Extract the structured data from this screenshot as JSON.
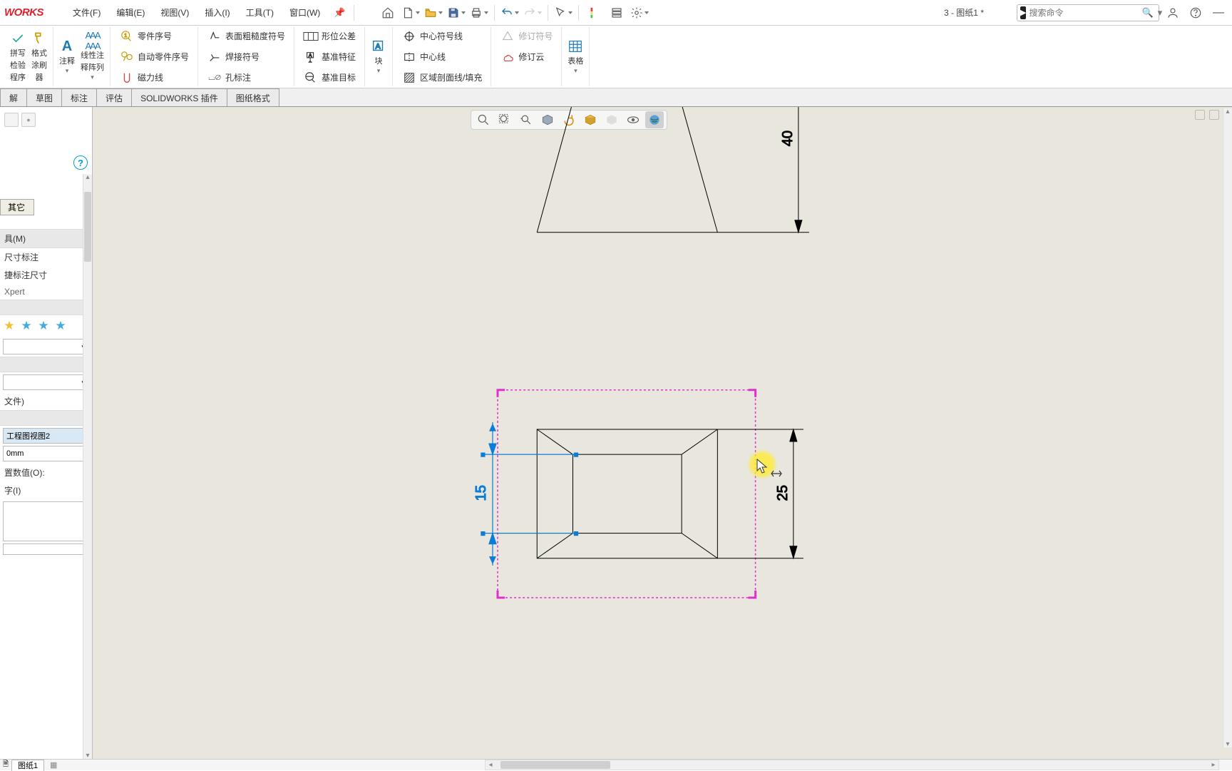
{
  "app": {
    "logo": "WORKS",
    "doc_title": "3 - 图纸1 *"
  },
  "menu": {
    "file": "文件(F)",
    "edit": "编辑(E)",
    "view": "视图(V)",
    "insert": "插入(I)",
    "tools": "工具(T)",
    "window": "窗口(W)"
  },
  "search": {
    "placeholder": "搜索命令"
  },
  "ribbon": {
    "col1a_l1": "拼写",
    "col1a_l2": "检验",
    "col1a_l3": "程序",
    "col1b_l1": "格式",
    "col1b_l2": "涂刷",
    "col1b_l3": "器",
    "col2_label": "注释",
    "col2b_l1": "线性注",
    "col2b_l2": "释阵列",
    "col3_r1": "零件序号",
    "col3_r2": "自动零件序号",
    "col3_r3": "磁力线",
    "col4_r1": "表面粗糙度符号",
    "col4_r2": "焊接符号",
    "col4_r3": "孔标注",
    "col5_r1": "形位公差",
    "col5_r2": "基准特征",
    "col5_r3": "基准目标",
    "col6": "块",
    "col7_r1": "中心符号线",
    "col7_r2": "中心线",
    "col7_r3": "区域剖面线/填充",
    "col8_r1": "修订符号",
    "col8_r2": "修订云",
    "col9": "表格"
  },
  "tabs": {
    "t1": "解",
    "t2": "草图",
    "t3": "标注",
    "t4": "评估",
    "t5": "SOLIDWORKS 插件",
    "t6": "图纸格式"
  },
  "panel": {
    "other_tab": "其它",
    "sect_m": "具(M)",
    "item_dim": "尺寸标注",
    "item_smart": "捷标注尺寸",
    "item_xpert": "Xpert",
    "file_suffix": "文件)",
    "view_name": "工程图视图2",
    "mm": "0mm",
    "offset": "置数值(O):",
    "text_sect": "字(I)"
  },
  "sheet": {
    "tab1": "图纸1"
  },
  "drawing": {
    "dim40": "40",
    "dim25": "25",
    "dim15": "15"
  }
}
